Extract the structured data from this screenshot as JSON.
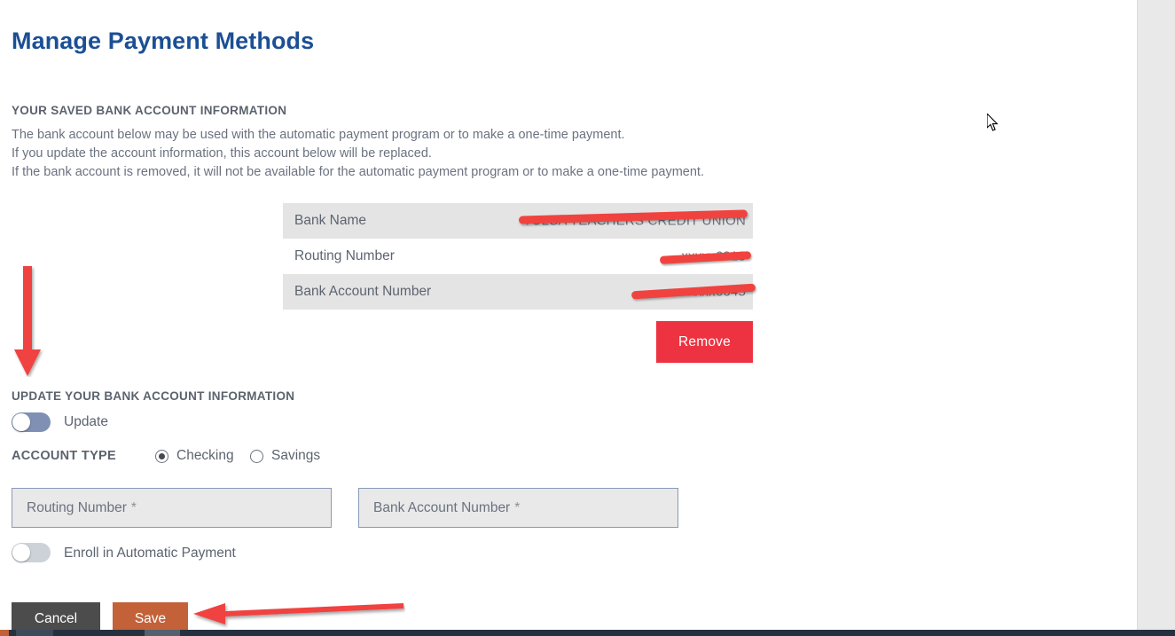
{
  "page": {
    "title": "Manage Payment Methods",
    "title_color": "#1b4f95"
  },
  "saved_section": {
    "heading": "YOUR SAVED BANK ACCOUNT INFORMATION",
    "info_lines": [
      "The bank account below may be used with the automatic payment program or to make a one-time payment.",
      "If you update the account information, this account below will be replaced.",
      "If the bank account is removed, it will not be available for the automatic payment program or to make a one-time payment."
    ],
    "table": {
      "rows": [
        {
          "label": "Bank Name",
          "value": "TULSA TEACHERS CREDIT UNION",
          "redacted": true
        },
        {
          "label": "Routing Number",
          "value": "xxxxx6818",
          "redacted": true
        },
        {
          "label": "Bank Account Number",
          "value": "xxxxxx6645",
          "redacted": true
        }
      ]
    },
    "remove_label": "Remove",
    "remove_color": "#ed3341"
  },
  "update_section": {
    "heading": "UPDATE YOUR BANK ACCOUNT INFORMATION",
    "update_toggle": {
      "label": "Update",
      "state": "off",
      "track_color": "#8090b4"
    },
    "account_type": {
      "label": "ACCOUNT TYPE",
      "options": [
        {
          "label": "Checking",
          "selected": true
        },
        {
          "label": "Savings",
          "selected": false
        }
      ]
    },
    "fields": [
      {
        "placeholder": "Routing Number",
        "value": "",
        "required_marker": "*"
      },
      {
        "placeholder": "Bank Account Number",
        "value": "",
        "required_marker": "*"
      }
    ],
    "enroll_toggle": {
      "label": "Enroll in Automatic Payment",
      "state": "off",
      "track_color": "#cdd1d8"
    }
  },
  "footer": {
    "cancel_label": "Cancel",
    "cancel_color": "#4c4c4c",
    "save_label": "Save",
    "save_color": "#c36239"
  },
  "annotations": {
    "arrow_color": "#f0433f",
    "down_arrow_target": "UPDATE YOUR BANK ACCOUNT INFORMATION",
    "left_arrow_target": "Save"
  }
}
